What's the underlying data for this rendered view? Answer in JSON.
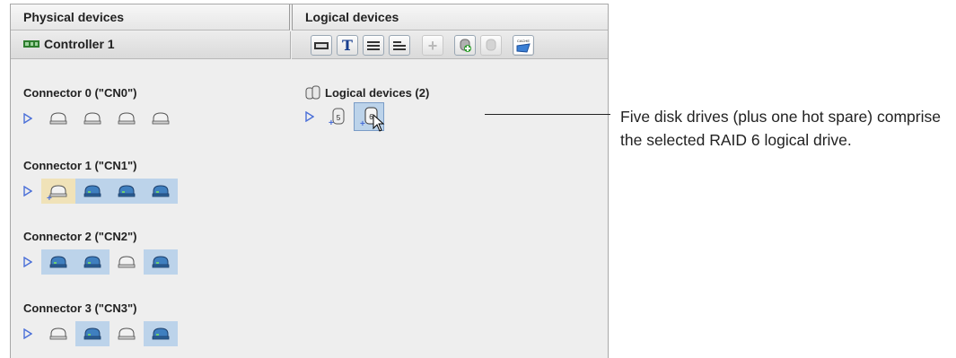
{
  "panels": {
    "physical_title": "Physical devices",
    "logical_title": "Logical devices"
  },
  "controller": {
    "label": "Controller 1"
  },
  "toolbar": {
    "buttons": [
      "chip-icon",
      "text-t-icon",
      "stripes-icon",
      "stack-icon",
      "add-icon",
      "add-drive-icon",
      "drive-icon",
      "cache-icon"
    ],
    "cache_text": "CACHE",
    "t_text": "T"
  },
  "connectors": [
    {
      "label": "Connector 0 (\"CN0\")",
      "drives": [
        "empty",
        "empty",
        "empty",
        "empty"
      ]
    },
    {
      "label": "Connector 1 (\"CN1\")",
      "drives": [
        "spare",
        "member",
        "member",
        "member"
      ]
    },
    {
      "label": "Connector 2 (\"CN2\")",
      "drives": [
        "member",
        "member",
        "empty",
        "member"
      ]
    },
    {
      "label": "Connector 3 (\"CN3\")",
      "drives": [
        "empty",
        "member",
        "empty",
        "member"
      ]
    }
  ],
  "logical": {
    "header": "Logical devices (2)",
    "drives": [
      {
        "raid": "5",
        "selected": false
      },
      {
        "raid": "6",
        "selected": true
      }
    ]
  },
  "callout": "Five disk drives (plus one hot spare) comprise the selected RAID 6 logical drive.",
  "colors": {
    "selection": "#bcd3ea",
    "spare_highlight": "#f0e2b8",
    "drive_member": "#3f7fbf"
  }
}
